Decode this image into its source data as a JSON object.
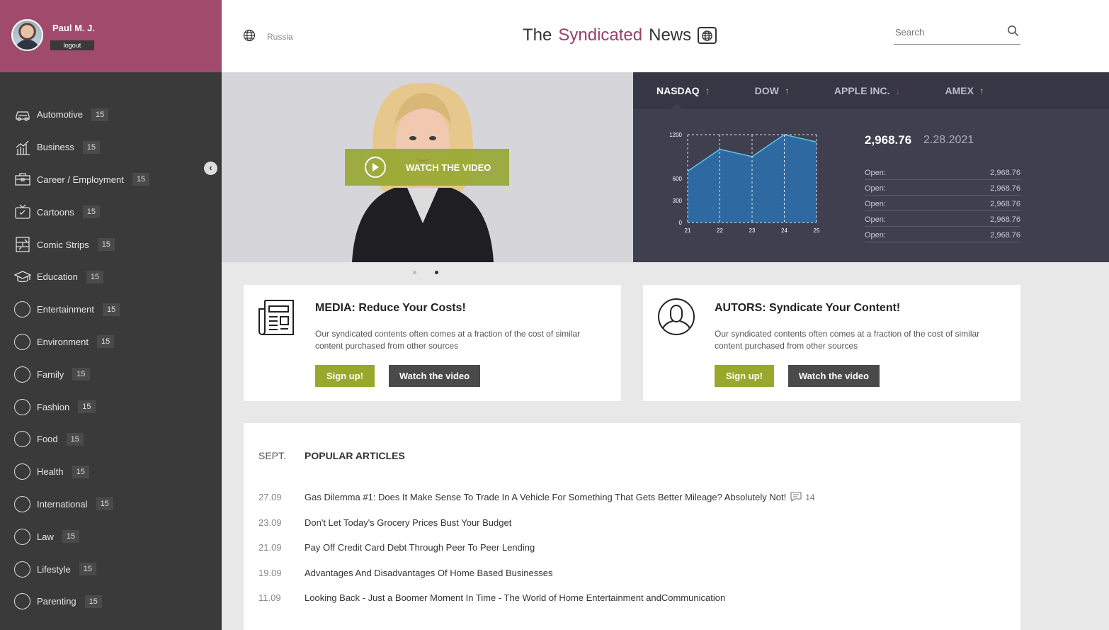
{
  "user": {
    "name": "Paul M. J.",
    "logout_label": "logout"
  },
  "sidebar": {
    "collapse_icon": "chevron-left-icon",
    "items": [
      {
        "label": "Automotive",
        "count": "15",
        "icon": "car-icon"
      },
      {
        "label": "Business",
        "count": "15",
        "icon": "bar-chart-icon"
      },
      {
        "label": "Career / Employment",
        "count": "15",
        "icon": "briefcase-icon"
      },
      {
        "label": "Cartoons",
        "count": "15",
        "icon": "tv-icon"
      },
      {
        "label": "Comic Strips",
        "count": "15",
        "icon": "comic-icon"
      },
      {
        "label": "Education",
        "count": "15",
        "icon": "graduation-cap-icon"
      },
      {
        "label": "Entertainment",
        "count": "15",
        "icon": "circle-icon"
      },
      {
        "label": "Environment",
        "count": "15",
        "icon": "circle-icon"
      },
      {
        "label": "Family",
        "count": "15",
        "icon": "circle-icon"
      },
      {
        "label": "Fashion",
        "count": "15",
        "icon": "circle-icon"
      },
      {
        "label": "Food",
        "count": "15",
        "icon": "circle-icon"
      },
      {
        "label": "Health",
        "count": "15",
        "icon": "circle-icon"
      },
      {
        "label": "International",
        "count": "15",
        "icon": "circle-icon"
      },
      {
        "label": "Law",
        "count": "15",
        "icon": "circle-icon"
      },
      {
        "label": "Lifestyle",
        "count": "15",
        "icon": "circle-icon"
      },
      {
        "label": "Parenting",
        "count": "15",
        "icon": "circle-icon"
      }
    ]
  },
  "header": {
    "region": "Russia",
    "logo_the": "The",
    "logo_mid": "Syndicated",
    "logo_end": "News",
    "search_placeholder": "Search"
  },
  "hero": {
    "watch_label": "WATCH THE VIDEO",
    "slides": 2,
    "active_slide": 2
  },
  "market": {
    "tabs": [
      {
        "label": "NASDAQ",
        "trend": "up",
        "arrow": "↑"
      },
      {
        "label": "DOW",
        "trend": "up",
        "arrow": "↑"
      },
      {
        "label": "APPLE INC.",
        "trend": "down",
        "arrow": "↓"
      },
      {
        "label": "AMEX",
        "trend": "up",
        "arrow": "↑"
      }
    ],
    "price": "2,968.76",
    "date": "2.28.2021",
    "stats": [
      {
        "label": "Open:",
        "value": "2,968.76"
      },
      {
        "label": "Open:",
        "value": "2,968.76"
      },
      {
        "label": "Open:",
        "value": "2,968.76"
      },
      {
        "label": "Open:",
        "value": "2,968.76"
      },
      {
        "label": "Open:",
        "value": "2,968.76"
      }
    ],
    "colors": {
      "up": "#a8c44a",
      "down": "#d03a6a",
      "area": "#2e6aa1",
      "line": "#5bc6e8"
    }
  },
  "chart_data": {
    "type": "area",
    "x": [
      21,
      22,
      23,
      24,
      25
    ],
    "xticks": [
      "21",
      "22",
      "23",
      "24",
      "25"
    ],
    "yticks": [
      "0",
      "300",
      "600",
      "1200"
    ],
    "y": [
      700,
      1000,
      900,
      1200,
      1100
    ],
    "ylim": [
      0,
      1200
    ],
    "grid": true
  },
  "cards": [
    {
      "title": "MEDIA: Reduce Your Costs!",
      "text": "Our syndicated contents often comes at a fraction of the cost of similar content purchased from other sources",
      "signup": "Sign up!",
      "watch": "Watch the video",
      "icon": "newspaper-icon"
    },
    {
      "title": "AUTORS: Syndicate Your Content!",
      "text": "Our syndicated contents often comes at a fraction of the cost of similar content purchased from other sources",
      "signup": "Sign up!",
      "watch": "Watch the video",
      "icon": "user-icon"
    }
  ],
  "articles": {
    "month": "SEPT.",
    "heading": "POPULAR ARTICLES",
    "items": [
      {
        "date": "27.09",
        "title": "Gas Dilemma #1: Does It Make Sense To Trade In A Vehicle For Something That Gets Better Mileage? Absolutely Not!",
        "comments": "14"
      },
      {
        "date": "23.09",
        "title": "Don't Let Today's Grocery Prices Bust Your Budget"
      },
      {
        "date": "21.09",
        "title": "Pay Off Credit Card Debt Through Peer To Peer Lending"
      },
      {
        "date": "19.09",
        "title": "Advantages And Disadvantages Of Home Based Businesses"
      },
      {
        "date": "11.09",
        "title": "Looking Back - Just a Boomer Moment In Time - The World of Home Entertainment andCommunication"
      }
    ]
  }
}
